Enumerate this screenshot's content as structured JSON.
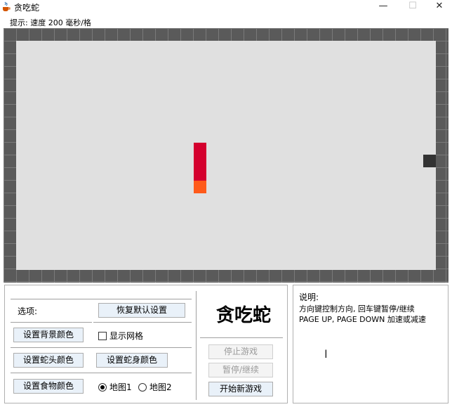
{
  "window": {
    "title": "贪吃蛇",
    "minimize_label": "—",
    "maximize_label": "☐",
    "close_label": "✕"
  },
  "hint": "提示: 速度 200 毫秒/格",
  "board": {
    "snake_body_color": "#d4002e",
    "snake_head_color": "#ff5a1a",
    "food_color": "#333333",
    "background_color": "#e0e0e0",
    "wall_color": "#5a5a5a"
  },
  "options": {
    "label": "选项:",
    "restore_defaults": "恢复默认设置",
    "set_bg_color": "设置背景颜色",
    "show_grid": "显示网格",
    "set_head_color": "设置蛇头颜色",
    "set_body_color": "设置蛇身颜色",
    "set_food_color": "设置食物颜色",
    "map1": "地图1",
    "map2": "地图2",
    "map_selected": "地图1"
  },
  "game_title": "贪吃蛇",
  "controls": {
    "stop": "停止游戏",
    "pause_resume": "暂停/继续",
    "new_game": "开始新游戏"
  },
  "help": {
    "title": "说明:",
    "line1": "方向键控制方向, 回车键暂停/继续",
    "line2": "PAGE UP, PAGE DOWN 加速或减速",
    "cursor": "I"
  }
}
